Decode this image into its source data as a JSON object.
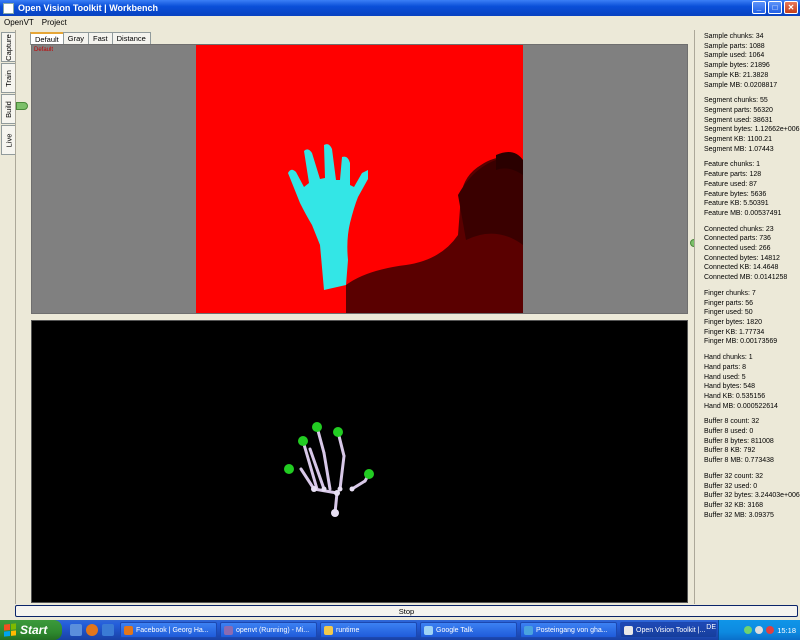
{
  "window": {
    "title": "Open Vision Toolkit | Workbench",
    "buttons": {
      "minimize": "_",
      "maximize": "□",
      "close": "✕"
    }
  },
  "menu": [
    "OpenVT",
    "Project"
  ],
  "left_tabs": [
    "Capture",
    "Train",
    "Build",
    "Live"
  ],
  "view_tabs": [
    "Default",
    "Gray",
    "Fast",
    "Distance"
  ],
  "view_label": "Default",
  "stats": [
    [
      "Sample chunks: 34",
      "Sample parts: 1088",
      "Sample used: 1064",
      "Sample bytes: 21896",
      "Sample KB: 21.3828",
      "Sample MB: 0.0208817"
    ],
    [
      "Segment chunks: 55",
      "Segment parts: 56320",
      "Segment used: 38631",
      "Segment bytes: 1.12662e+006",
      "Segment KB: 1100.21",
      "Segment MB: 1.07443"
    ],
    [
      "Feature chunks: 1",
      "Feature parts: 128",
      "Feature used: 87",
      "Feature bytes: 5636",
      "Feature KB: 5.50391",
      "Feature MB: 0.00537491"
    ],
    [
      "Connected chunks: 23",
      "Connected parts: 736",
      "Connected used: 266",
      "Connected bytes: 14812",
      "Connected KB: 14.4648",
      "Connected MB: 0.0141258"
    ],
    [
      "Finger chunks: 7",
      "Finger parts: 56",
      "Finger used: 50",
      "Finger bytes: 1820",
      "Finger KB: 1.77734",
      "Finger MB: 0.00173569"
    ],
    [
      "Hand chunks: 1",
      "Hand parts: 8",
      "Hand used: 5",
      "Hand bytes: 548",
      "Hand KB: 0.535156",
      "Hand MB: 0.000522614"
    ],
    [
      "Buffer 8 count: 32",
      "Buffer 8 used: 0",
      "Buffer 8 bytes: 811008",
      "Buffer 8 KB: 792",
      "Buffer 8 MB: 0.773438"
    ],
    [
      "Buffer 32 count: 32",
      "Buffer 32 used: 0",
      "Buffer 32 bytes: 3.24403e+006",
      "Buffer 32 KB: 3168",
      "Buffer 32 MB: 3.09375"
    ]
  ],
  "stop_label": "Stop",
  "taskbar": {
    "start": "Start",
    "tasks": [
      {
        "label": "Facebook | Georg Ha...",
        "icon_color": "#e2761b"
      },
      {
        "label": "openvt (Running) - Mi...",
        "icon_color": "#8c6bb1"
      },
      {
        "label": "runtime",
        "icon_color": "#f2c94c"
      },
      {
        "label": "Google Talk",
        "icon_color": "#9fd3f5"
      },
      {
        "label": "Posteingang von gha...",
        "icon_color": "#4aa3df"
      },
      {
        "label": "Open Vision Toolkit |...",
        "icon_color": "#e8e8e8"
      }
    ],
    "active_task": 5,
    "language": "DE",
    "clock": "15:18"
  },
  "colors": {
    "camera_bg": "#ff0000",
    "hand_mask": "#33e6e6",
    "joint_green": "#22cc22",
    "bone": "#d8c8e8"
  }
}
